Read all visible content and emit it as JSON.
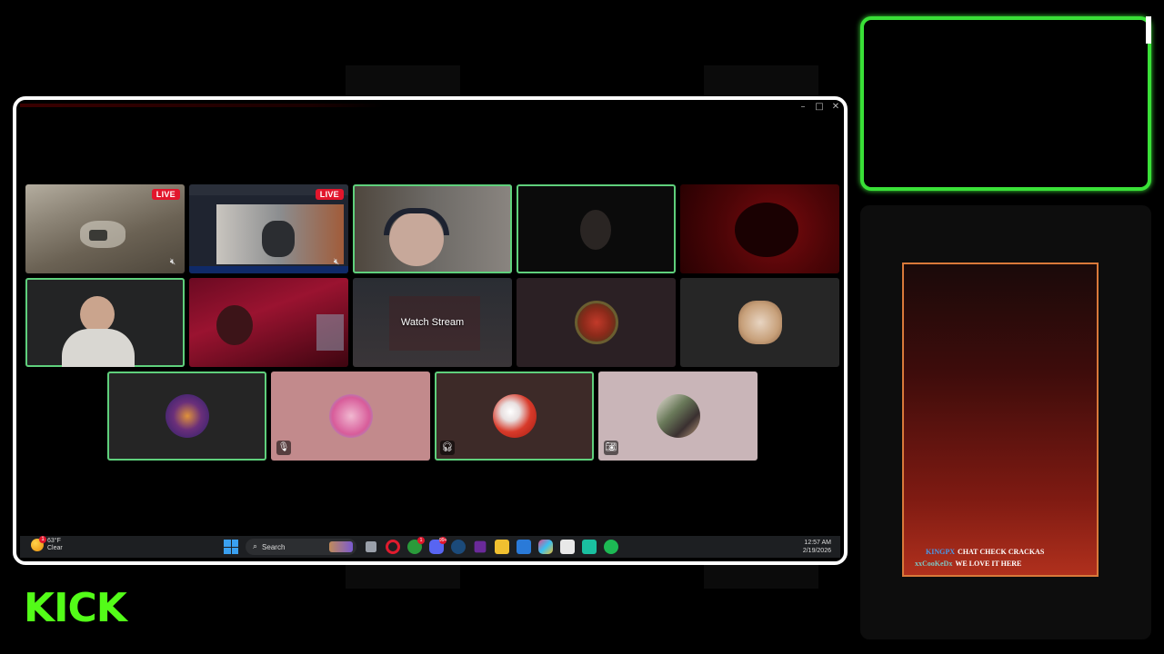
{
  "overlay": {
    "brand": "KICK",
    "brand_color": "#53fc18",
    "cam_frame_color": "#39e037"
  },
  "window": {
    "controls": [
      "–",
      "□",
      "✕"
    ]
  },
  "tiles": [
    {
      "id": "t1",
      "kind": "video",
      "badge": "LIVE",
      "muted": true,
      "active": false,
      "scene": "offroad-game"
    },
    {
      "id": "t2",
      "kind": "video",
      "badge": "LIVE",
      "muted": true,
      "active": false,
      "scene": "garage-stream"
    },
    {
      "id": "t3",
      "kind": "camera",
      "active": true,
      "scene": "man-headset"
    },
    {
      "id": "t4",
      "kind": "camera",
      "active": true,
      "scene": "dark-room"
    },
    {
      "id": "t5",
      "kind": "camera",
      "active": false,
      "scene": "red-light"
    },
    {
      "id": "t6",
      "kind": "camera",
      "active": true,
      "scene": "man-hoodie"
    },
    {
      "id": "t7",
      "kind": "camera",
      "active": false,
      "scene": "red-neon"
    },
    {
      "id": "t8",
      "kind": "stream",
      "button": "Watch Stream",
      "active": false
    },
    {
      "id": "t9",
      "kind": "avatar",
      "active": false,
      "avatar": "badge-logo"
    },
    {
      "id": "t10",
      "kind": "avatar",
      "active": false,
      "avatar": "cat-plush"
    },
    {
      "id": "t11",
      "kind": "avatar",
      "active": true,
      "avatar": "purple-glow"
    },
    {
      "id": "t12",
      "kind": "avatar",
      "active": false,
      "avatar": "pink-character",
      "corner": "mic-off-icon"
    },
    {
      "id": "t13",
      "kind": "avatar",
      "active": true,
      "avatar": "santa-ball",
      "corner": "headset-icon"
    },
    {
      "id": "t14",
      "kind": "avatar",
      "active": false,
      "avatar": "people-photo",
      "corner": "camera-off-icon"
    }
  ],
  "taskbar": {
    "weather_temp": "63°F",
    "weather_cond": "Clear",
    "weather_alert": "1",
    "search_label": "Search",
    "discord_badge": "99+",
    "xbox_badge": "1",
    "time": "12:57 AM",
    "date": "2/19/2026"
  },
  "chat": {
    "messages": [
      {
        "user": "KINGPX",
        "text": "CHAT CHECK CRACKAS"
      },
      {
        "user": "xxCooKeDx",
        "text": "WE LOVE IT HERE"
      }
    ]
  }
}
